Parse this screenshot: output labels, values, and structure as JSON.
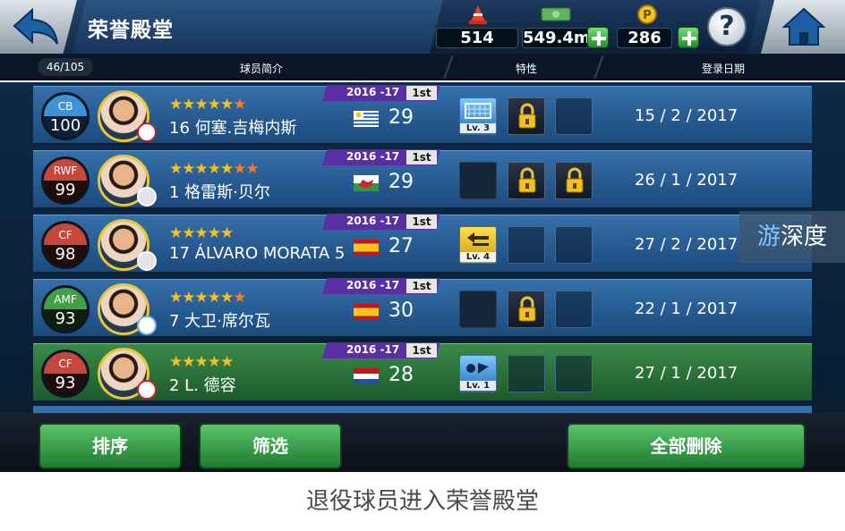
{
  "header": {
    "title": "荣誉殿堂",
    "resources": {
      "cones": "514",
      "cash": "549.4m",
      "coins": "286"
    },
    "help_label": "?"
  },
  "table": {
    "count": "46/105",
    "columns": {
      "profile": "球员简介",
      "traits": "特性",
      "date": "登录日期"
    }
  },
  "players": [
    {
      "pos": "CB",
      "ovr": "100",
      "pos_color": "blue",
      "stars_gold": 5,
      "stars_orange": 1,
      "name": "16 何塞.吉梅内斯",
      "season": "2016 -17",
      "rank": "1st",
      "nation": "uruguay",
      "age": "29",
      "date": "15 / 2 / 2017",
      "skill1": "blue",
      "skill1_lv": "Lv. 3",
      "lock1": true,
      "lock2": false,
      "row_color": "blue"
    },
    {
      "pos": "RWF",
      "ovr": "99",
      "pos_color": "red",
      "stars_gold": 5,
      "stars_orange": 2,
      "name": "1 格雷斯·贝尔",
      "season": "2016 -17",
      "rank": "1st",
      "nation": "wales",
      "age": "29",
      "date": "26 / 1 / 2017",
      "skill1": "dark",
      "skill1_lv": "",
      "lock1": true,
      "lock2": true,
      "row_color": "blue"
    },
    {
      "pos": "CF",
      "ovr": "98",
      "pos_color": "red",
      "stars_gold": 5,
      "stars_orange": 0,
      "name": "17 ÁLVARO MORATA 5",
      "season": "2016 -17",
      "rank": "1st",
      "nation": "spain",
      "age": "27",
      "date": "27 / 2 / 2017",
      "skill1": "yellow",
      "skill1_lv": "Lv. 4",
      "lock1": false,
      "lock2": false,
      "row_color": "blue"
    },
    {
      "pos": "AMF",
      "ovr": "93",
      "pos_color": "green",
      "stars_gold": 5,
      "stars_orange": 1,
      "name": "7 大卫·席尔瓦",
      "season": "2016 -17",
      "rank": "1st",
      "nation": "spain",
      "age": "30",
      "date": "22 / 1 / 2017",
      "skill1": "dark",
      "skill1_lv": "",
      "lock1": true,
      "lock2": false,
      "row_color": "blue"
    },
    {
      "pos": "CF",
      "ovr": "93",
      "pos_color": "red",
      "stars_gold": 5,
      "stars_orange": 0,
      "name": "2 L. 德容",
      "season": "2016 -17",
      "rank": "1st",
      "nation": "netherlands",
      "age": "28",
      "date": "27 / 1 / 2017",
      "skill1": "blue",
      "skill1_lv": "Lv. 1",
      "lock1": false,
      "lock2": false,
      "row_color": "green"
    }
  ],
  "buttons": {
    "sort": "排序",
    "filter": "筛选",
    "delete_all": "全部删除"
  },
  "watermark": {
    "first": "游",
    "rest": "深度"
  },
  "caption": "退役球员进入荣誉殿堂"
}
